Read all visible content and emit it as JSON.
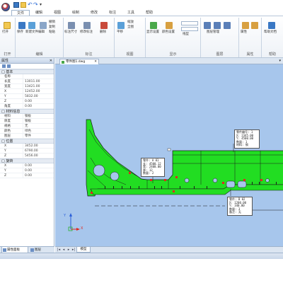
{
  "ribbon": {
    "tabs": [
      {
        "label": "文件",
        "active": true
      },
      {
        "label": "编辑",
        "active": false
      },
      {
        "label": "视图",
        "active": false
      },
      {
        "label": "绘制",
        "active": false
      },
      {
        "label": "修改",
        "active": false
      },
      {
        "label": "标注",
        "active": false
      },
      {
        "label": "工具",
        "active": false
      },
      {
        "label": "帮助",
        "active": false
      }
    ],
    "groups": {
      "group1_title": "打开",
      "group2_title": "编辑",
      "group3_title": "标注",
      "group4_title": "视图",
      "group5_title": "显示",
      "group6_title": "图层",
      "group7_title": "属性",
      "group8_title": "帮助"
    },
    "buttons": {
      "open": "打开",
      "save": "保存",
      "new": "新建文件",
      "edit": "编辑",
      "undo": "撤销",
      "copy": "复制",
      "paste": "粘贴",
      "mark1": "标注尺寸",
      "mark2": "修改标注",
      "mark3": "删除",
      "view1": "平移",
      "view2": "缩放",
      "view3": "全图",
      "show1": "显示设置",
      "show2": "颜色设置",
      "show3": "线型",
      "layer1": "图层管理",
      "prop1": "属性",
      "prop2": "修改属性",
      "help1": "帮助文档",
      "help2": "关于"
    }
  },
  "panel": {
    "title": "属性",
    "pin": "✕",
    "section1": {
      "title": "□ 基本",
      "rows": [
        {
          "key": "名称",
          "val": ""
        },
        {
          "key": "长度",
          "val": "13011.00"
        },
        {
          "key": "宽度",
          "val": "13421.00"
        },
        {
          "key": "X",
          "val": "12452.00"
        },
        {
          "key": "Y",
          "val": "5832.00"
        },
        {
          "key": "Z",
          "val": "0.00"
        },
        {
          "key": "角度",
          "val": "0.00"
        }
      ]
    },
    "section2": {
      "title": "□ 材料信息",
      "rows": [
        {
          "key": "材料",
          "val": "钢板"
        },
        {
          "key": "厚度",
          "val": "钢板"
        },
        {
          "key": "规格",
          "val": "无"
        },
        {
          "key": "颜色",
          "val": "绿色"
        },
        {
          "key": "图层",
          "val": "零件"
        }
      ]
    },
    "section3": {
      "title": "□ 位置",
      "rows": [
        {
          "key": "X",
          "val": "3452.00"
        },
        {
          "key": "Y",
          "val": "6790.00"
        },
        {
          "key": "Z",
          "val": "5456.00"
        }
      ]
    },
    "section4": {
      "title": "□ 旋转",
      "rows": [
        {
          "key": "X",
          "val": "0.00"
        },
        {
          "key": "Y",
          "val": "0.00"
        },
        {
          "key": "Z",
          "val": "0.00"
        }
      ]
    },
    "bottom_tabs": [
      {
        "label": "属性面板",
        "active": true
      },
      {
        "label": "图层",
        "active": false
      }
    ]
  },
  "document": {
    "tab_label": "零件图1.dwg",
    "tab_close": "✕",
    "pin": "▾",
    "sheet_tab": "模型"
  },
  "canvas": {
    "background": "#a7c6ec",
    "part_color": "#22dd22",
    "axis_x_label": "X",
    "axis_y_label": "Y",
    "notes": [
      {
        "id": "note-top-right",
        "lines": [
          "零件编号: 1",
          "X: 2345.00",
          "Y: 4500.00",
          "数量: 1",
          "材料: 钢"
        ]
      },
      {
        "id": "note-center",
        "lines": [
          "零件: A 01",
          "长: 4500.12",
          "宽: 2400.00",
          "厚: 12",
          "数量: 2"
        ]
      },
      {
        "id": "note-bottom-right",
        "lines": [
          "零件: B 02",
          "X: 1200.00",
          "Y: 340.00",
          "数量: 3",
          "备注: 无"
        ]
      }
    ]
  }
}
